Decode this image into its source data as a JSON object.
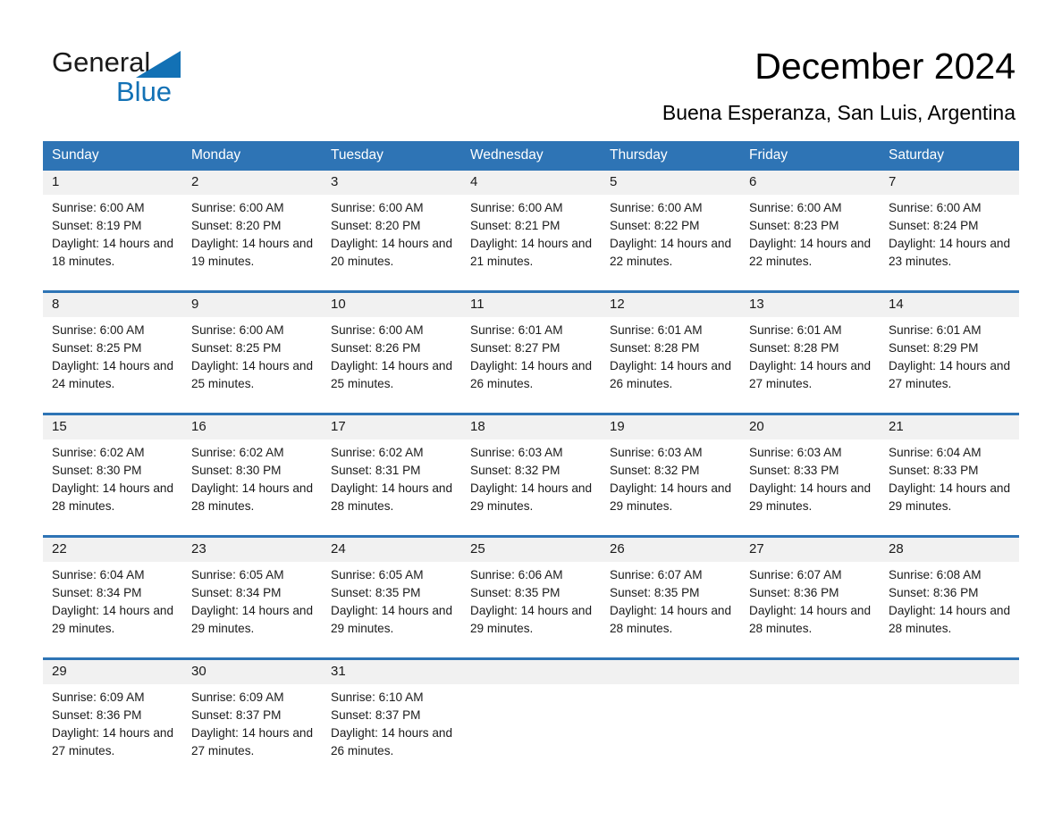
{
  "brand": {
    "name_part1": "General",
    "name_part2": "Blue",
    "logo_color": "#1271b5"
  },
  "header": {
    "title": "December 2024",
    "location": "Buena Esperanza, San Luis, Argentina"
  },
  "theme": {
    "header_blue": "#2e74b5",
    "date_band": "#f1f1f1",
    "text": "#1a1a1a",
    "page_background": "#ffffff"
  },
  "weekday_headers": [
    "Sunday",
    "Monday",
    "Tuesday",
    "Wednesday",
    "Thursday",
    "Friday",
    "Saturday"
  ],
  "labels": {
    "sunrise_prefix": "Sunrise:",
    "sunset_prefix": "Sunset:",
    "daylight_prefix": "Daylight:"
  },
  "weeks": [
    {
      "days": [
        {
          "date": "1",
          "sunrise": "Sunrise: 6:00 AM",
          "sunset": "Sunset: 8:19 PM",
          "daylight": "Daylight: 14 hours and 18 minutes."
        },
        {
          "date": "2",
          "sunrise": "Sunrise: 6:00 AM",
          "sunset": "Sunset: 8:20 PM",
          "daylight": "Daylight: 14 hours and 19 minutes."
        },
        {
          "date": "3",
          "sunrise": "Sunrise: 6:00 AM",
          "sunset": "Sunset: 8:20 PM",
          "daylight": "Daylight: 14 hours and 20 minutes."
        },
        {
          "date": "4",
          "sunrise": "Sunrise: 6:00 AM",
          "sunset": "Sunset: 8:21 PM",
          "daylight": "Daylight: 14 hours and 21 minutes."
        },
        {
          "date": "5",
          "sunrise": "Sunrise: 6:00 AM",
          "sunset": "Sunset: 8:22 PM",
          "daylight": "Daylight: 14 hours and 22 minutes."
        },
        {
          "date": "6",
          "sunrise": "Sunrise: 6:00 AM",
          "sunset": "Sunset: 8:23 PM",
          "daylight": "Daylight: 14 hours and 22 minutes."
        },
        {
          "date": "7",
          "sunrise": "Sunrise: 6:00 AM",
          "sunset": "Sunset: 8:24 PM",
          "daylight": "Daylight: 14 hours and 23 minutes."
        }
      ]
    },
    {
      "days": [
        {
          "date": "8",
          "sunrise": "Sunrise: 6:00 AM",
          "sunset": "Sunset: 8:25 PM",
          "daylight": "Daylight: 14 hours and 24 minutes."
        },
        {
          "date": "9",
          "sunrise": "Sunrise: 6:00 AM",
          "sunset": "Sunset: 8:25 PM",
          "daylight": "Daylight: 14 hours and 25 minutes."
        },
        {
          "date": "10",
          "sunrise": "Sunrise: 6:00 AM",
          "sunset": "Sunset: 8:26 PM",
          "daylight": "Daylight: 14 hours and 25 minutes."
        },
        {
          "date": "11",
          "sunrise": "Sunrise: 6:01 AM",
          "sunset": "Sunset: 8:27 PM",
          "daylight": "Daylight: 14 hours and 26 minutes."
        },
        {
          "date": "12",
          "sunrise": "Sunrise: 6:01 AM",
          "sunset": "Sunset: 8:28 PM",
          "daylight": "Daylight: 14 hours and 26 minutes."
        },
        {
          "date": "13",
          "sunrise": "Sunrise: 6:01 AM",
          "sunset": "Sunset: 8:28 PM",
          "daylight": "Daylight: 14 hours and 27 minutes."
        },
        {
          "date": "14",
          "sunrise": "Sunrise: 6:01 AM",
          "sunset": "Sunset: 8:29 PM",
          "daylight": "Daylight: 14 hours and 27 minutes."
        }
      ]
    },
    {
      "days": [
        {
          "date": "15",
          "sunrise": "Sunrise: 6:02 AM",
          "sunset": "Sunset: 8:30 PM",
          "daylight": "Daylight: 14 hours and 28 minutes."
        },
        {
          "date": "16",
          "sunrise": "Sunrise: 6:02 AM",
          "sunset": "Sunset: 8:30 PM",
          "daylight": "Daylight: 14 hours and 28 minutes."
        },
        {
          "date": "17",
          "sunrise": "Sunrise: 6:02 AM",
          "sunset": "Sunset: 8:31 PM",
          "daylight": "Daylight: 14 hours and 28 minutes."
        },
        {
          "date": "18",
          "sunrise": "Sunrise: 6:03 AM",
          "sunset": "Sunset: 8:32 PM",
          "daylight": "Daylight: 14 hours and 29 minutes."
        },
        {
          "date": "19",
          "sunrise": "Sunrise: 6:03 AM",
          "sunset": "Sunset: 8:32 PM",
          "daylight": "Daylight: 14 hours and 29 minutes."
        },
        {
          "date": "20",
          "sunrise": "Sunrise: 6:03 AM",
          "sunset": "Sunset: 8:33 PM",
          "daylight": "Daylight: 14 hours and 29 minutes."
        },
        {
          "date": "21",
          "sunrise": "Sunrise: 6:04 AM",
          "sunset": "Sunset: 8:33 PM",
          "daylight": "Daylight: 14 hours and 29 minutes."
        }
      ]
    },
    {
      "days": [
        {
          "date": "22",
          "sunrise": "Sunrise: 6:04 AM",
          "sunset": "Sunset: 8:34 PM",
          "daylight": "Daylight: 14 hours and 29 minutes."
        },
        {
          "date": "23",
          "sunrise": "Sunrise: 6:05 AM",
          "sunset": "Sunset: 8:34 PM",
          "daylight": "Daylight: 14 hours and 29 minutes."
        },
        {
          "date": "24",
          "sunrise": "Sunrise: 6:05 AM",
          "sunset": "Sunset: 8:35 PM",
          "daylight": "Daylight: 14 hours and 29 minutes."
        },
        {
          "date": "25",
          "sunrise": "Sunrise: 6:06 AM",
          "sunset": "Sunset: 8:35 PM",
          "daylight": "Daylight: 14 hours and 29 minutes."
        },
        {
          "date": "26",
          "sunrise": "Sunrise: 6:07 AM",
          "sunset": "Sunset: 8:35 PM",
          "daylight": "Daylight: 14 hours and 28 minutes."
        },
        {
          "date": "27",
          "sunrise": "Sunrise: 6:07 AM",
          "sunset": "Sunset: 8:36 PM",
          "daylight": "Daylight: 14 hours and 28 minutes."
        },
        {
          "date": "28",
          "sunrise": "Sunrise: 6:08 AM",
          "sunset": "Sunset: 8:36 PM",
          "daylight": "Daylight: 14 hours and 28 minutes."
        }
      ]
    },
    {
      "days": [
        {
          "date": "29",
          "sunrise": "Sunrise: 6:09 AM",
          "sunset": "Sunset: 8:36 PM",
          "daylight": "Daylight: 14 hours and 27 minutes."
        },
        {
          "date": "30",
          "sunrise": "Sunrise: 6:09 AM",
          "sunset": "Sunset: 8:37 PM",
          "daylight": "Daylight: 14 hours and 27 minutes."
        },
        {
          "date": "31",
          "sunrise": "Sunrise: 6:10 AM",
          "sunset": "Sunset: 8:37 PM",
          "daylight": "Daylight: 14 hours and 26 minutes."
        },
        {
          "date": "",
          "sunrise": "",
          "sunset": "",
          "daylight": ""
        },
        {
          "date": "",
          "sunrise": "",
          "sunset": "",
          "daylight": ""
        },
        {
          "date": "",
          "sunrise": "",
          "sunset": "",
          "daylight": ""
        },
        {
          "date": "",
          "sunrise": "",
          "sunset": "",
          "daylight": ""
        }
      ]
    }
  ]
}
